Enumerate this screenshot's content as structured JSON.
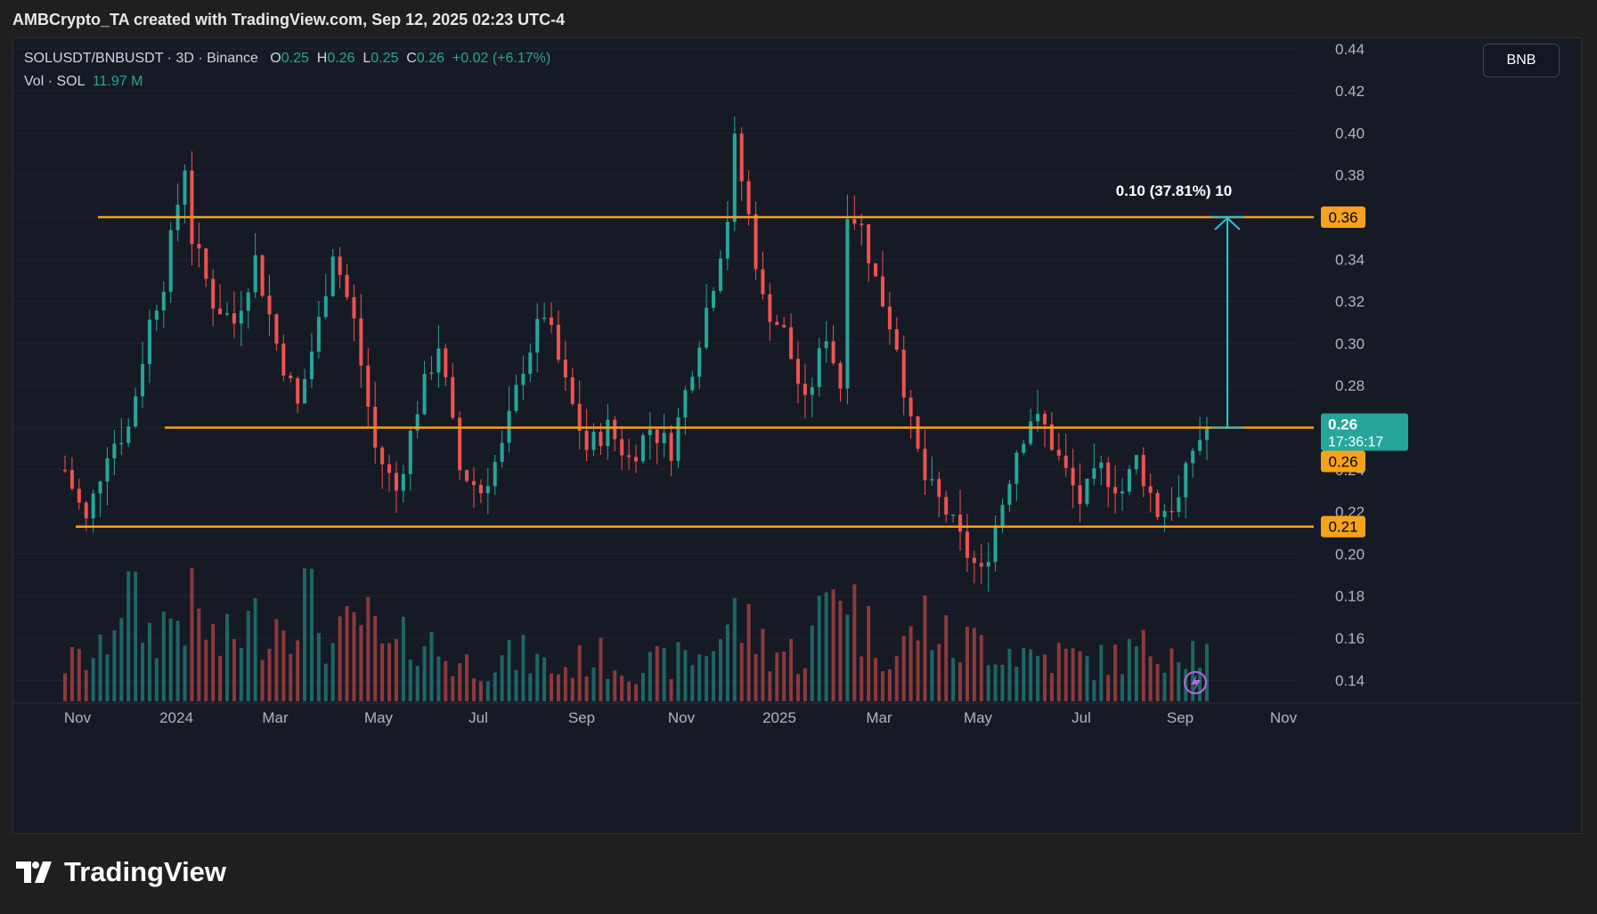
{
  "header": {
    "attribution": "AMBCrypto_TA created with TradingView.com, Sep 12, 2025 02:23 UTC-4"
  },
  "legend": {
    "symbol": "SOLUSDT/BNBUSDT",
    "interval": "3D",
    "exchange": "Binance",
    "o_label": "O",
    "o_value": "0.25",
    "h_label": "H",
    "h_value": "0.26",
    "l_label": "L",
    "l_value": "0.25",
    "c_label": "C",
    "c_value": "0.26",
    "change": "+0.02 (+6.17%)",
    "vol_label": "Vol · SOL",
    "vol_value": "11.97 M"
  },
  "currency_button": "BNB",
  "footer": {
    "brand": "TradingView"
  },
  "colors": {
    "background": "#161a25",
    "up": "#26a69a",
    "down": "#ef5350",
    "level_line": "#f7a21b",
    "measure": "#26c6da"
  },
  "chart_data": {
    "type": "candlestick",
    "y_axis": {
      "ticks": [
        "0.14",
        "0.16",
        "0.18",
        "0.20",
        "0.22",
        "0.24",
        "0.26",
        "0.28",
        "0.30",
        "0.32",
        "0.34",
        "0.36",
        "0.38",
        "0.40",
        "0.42",
        "0.44"
      ],
      "range": [
        0.13,
        0.445
      ]
    },
    "x_axis": {
      "ticks": [
        "Nov",
        "2024",
        "Mar",
        "May",
        "Jul",
        "Sep",
        "Nov",
        "2025",
        "Mar",
        "May",
        "Jul",
        "Sep",
        "Nov"
      ]
    },
    "horizontal_levels": [
      {
        "label": "0.36",
        "value": 0.36
      },
      {
        "label": "0.26",
        "value": 0.26
      },
      {
        "label": "0.21",
        "value": 0.213
      }
    ],
    "last_price": {
      "value_label": "0.26",
      "countdown": "17:36:17",
      "value": 0.26
    },
    "measure": {
      "label": "0.10 (37.81%) 10",
      "from": 0.26,
      "to": 0.36
    },
    "price_keypoints": [
      [
        0,
        0.24
      ],
      [
        3,
        0.215
      ],
      [
        6,
        0.25
      ],
      [
        9,
        0.26
      ],
      [
        12,
        0.31
      ],
      [
        14,
        0.33
      ],
      [
        17,
        0.385
      ],
      [
        18,
        0.35
      ],
      [
        21,
        0.32
      ],
      [
        24,
        0.31
      ],
      [
        27,
        0.34
      ],
      [
        30,
        0.3
      ],
      [
        33,
        0.27
      ],
      [
        36,
        0.31
      ],
      [
        38,
        0.345
      ],
      [
        41,
        0.31
      ],
      [
        44,
        0.25
      ],
      [
        47,
        0.23
      ],
      [
        50,
        0.27
      ],
      [
        53,
        0.3
      ],
      [
        56,
        0.24
      ],
      [
        59,
        0.23
      ],
      [
        62,
        0.25
      ],
      [
        65,
        0.29
      ],
      [
        68,
        0.315
      ],
      [
        71,
        0.28
      ],
      [
        74,
        0.25
      ],
      [
        77,
        0.26
      ],
      [
        80,
        0.245
      ],
      [
        83,
        0.26
      ],
      [
        86,
        0.25
      ],
      [
        89,
        0.29
      ],
      [
        92,
        0.33
      ],
      [
        94,
        0.36
      ],
      [
        95,
        0.395
      ],
      [
        97,
        0.36
      ],
      [
        99,
        0.32
      ],
      [
        102,
        0.305
      ],
      [
        105,
        0.27
      ],
      [
        108,
        0.305
      ],
      [
        110,
        0.28
      ],
      [
        111,
        0.365
      ],
      [
        113,
        0.355
      ],
      [
        115,
        0.33
      ],
      [
        118,
        0.3
      ],
      [
        120,
        0.26
      ],
      [
        122,
        0.235
      ],
      [
        125,
        0.22
      ],
      [
        128,
        0.2
      ],
      [
        130,
        0.19
      ],
      [
        133,
        0.225
      ],
      [
        135,
        0.25
      ],
      [
        137,
        0.265
      ],
      [
        139,
        0.26
      ],
      [
        141,
        0.245
      ],
      [
        144,
        0.225
      ],
      [
        147,
        0.24
      ],
      [
        150,
        0.23
      ],
      [
        152,
        0.245
      ],
      [
        155,
        0.22
      ],
      [
        158,
        0.225
      ],
      [
        160,
        0.25
      ],
      [
        162,
        0.26
      ]
    ],
    "volume_keypoints": [
      [
        0,
        0.25
      ],
      [
        5,
        0.3
      ],
      [
        8,
        0.75
      ],
      [
        12,
        0.45
      ],
      [
        15,
        0.55
      ],
      [
        18,
        0.6
      ],
      [
        22,
        0.35
      ],
      [
        26,
        0.5
      ],
      [
        30,
        0.55
      ],
      [
        34,
        0.7
      ],
      [
        38,
        0.35
      ],
      [
        42,
        0.55
      ],
      [
        46,
        0.3
      ],
      [
        50,
        0.45
      ],
      [
        55,
        0.25
      ],
      [
        60,
        0.25
      ],
      [
        65,
        0.3
      ],
      [
        70,
        0.2
      ],
      [
        75,
        0.3
      ],
      [
        80,
        0.22
      ],
      [
        85,
        0.25
      ],
      [
        90,
        0.3
      ],
      [
        95,
        0.55
      ],
      [
        100,
        0.35
      ],
      [
        105,
        0.3
      ],
      [
        110,
        0.9
      ],
      [
        113,
        0.5
      ],
      [
        118,
        0.3
      ],
      [
        122,
        0.55
      ],
      [
        126,
        0.35
      ],
      [
        130,
        0.4
      ],
      [
        134,
        0.35
      ],
      [
        138,
        0.3
      ],
      [
        142,
        0.3
      ],
      [
        146,
        0.25
      ],
      [
        150,
        0.3
      ],
      [
        154,
        0.35
      ],
      [
        158,
        0.4
      ],
      [
        162,
        0.3
      ]
    ]
  }
}
